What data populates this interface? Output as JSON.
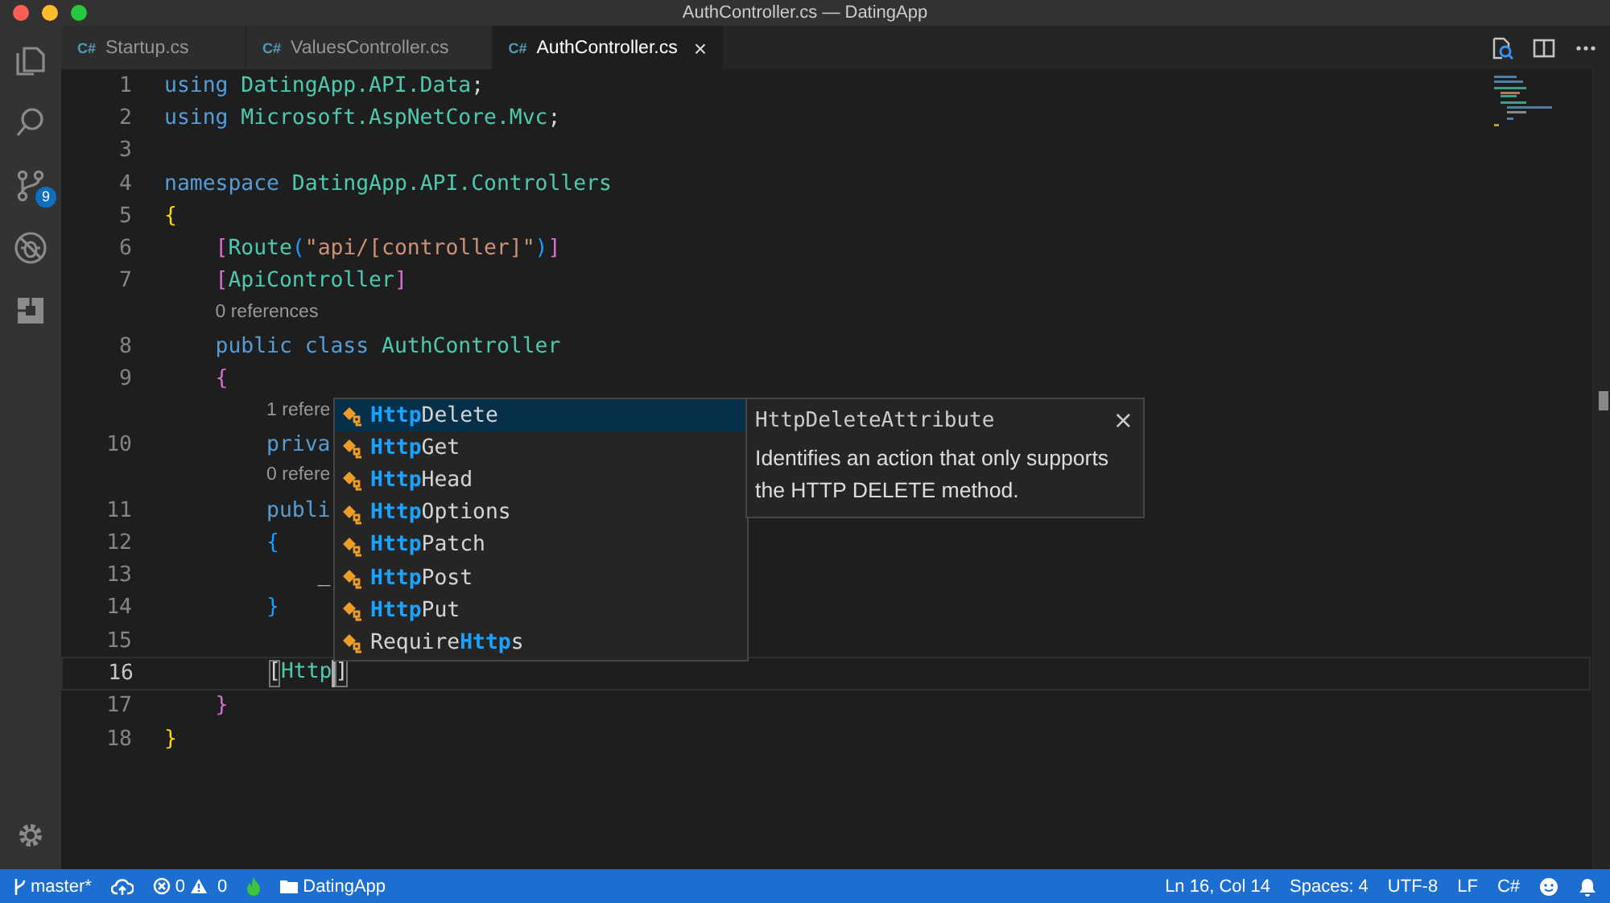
{
  "window": {
    "title": "AuthController.cs — DatingApp"
  },
  "activity_bar": {
    "source_control_badge": "9"
  },
  "tabs": [
    {
      "lang": "C#",
      "label": "Startup.cs",
      "selected": false
    },
    {
      "lang": "C#",
      "label": "ValuesController.cs",
      "selected": false
    },
    {
      "lang": "C#",
      "label": "AuthController.cs",
      "selected": true,
      "close": "×"
    }
  ],
  "editor": {
    "rows": [
      {
        "kind": "code",
        "number": "1",
        "current": false,
        "tokens": [
          {
            "kind": "keyword",
            "text": "using"
          },
          {
            "kind": "type",
            "text": " DatingApp.API.Data"
          },
          {
            "kind": "plain",
            "text": ";"
          }
        ]
      },
      {
        "kind": "code",
        "number": "2",
        "current": false,
        "tokens": [
          {
            "kind": "keyword",
            "text": "using"
          },
          {
            "kind": "type",
            "text": " Microsoft.AspNetCore.Mvc"
          },
          {
            "kind": "plain",
            "text": ";"
          }
        ]
      },
      {
        "kind": "code",
        "number": "3",
        "current": false,
        "tokens": []
      },
      {
        "kind": "code",
        "number": "4",
        "current": false,
        "tokens": [
          {
            "kind": "keyword",
            "text": "namespace"
          },
          {
            "kind": "type",
            "text": " DatingApp.API.Controllers"
          }
        ]
      },
      {
        "kind": "code",
        "number": "5",
        "current": false,
        "tokens": [
          {
            "kind": "brace1",
            "text": "{"
          }
        ]
      },
      {
        "kind": "code",
        "number": "6",
        "current": false,
        "tokens": [
          {
            "kind": "brace2",
            "text": "    ["
          },
          {
            "kind": "type",
            "text": "Route"
          },
          {
            "kind": "brace3",
            "text": "("
          },
          {
            "kind": "string",
            "text": "\"api/[controller]\""
          },
          {
            "kind": "brace3",
            "text": ")"
          },
          {
            "kind": "brace2",
            "text": "]"
          }
        ]
      },
      {
        "kind": "code",
        "number": "7",
        "current": false,
        "tokens": [
          {
            "kind": "brace2",
            "text": "    ["
          },
          {
            "kind": "type",
            "text": "ApiController"
          },
          {
            "kind": "brace2",
            "text": "]"
          }
        ]
      },
      {
        "kind": "codelens",
        "text": "    0 references"
      },
      {
        "kind": "code",
        "number": "8",
        "current": false,
        "tokens": [
          {
            "kind": "keyword",
            "text": "    public class"
          },
          {
            "kind": "type",
            "text": " AuthController"
          }
        ]
      },
      {
        "kind": "code",
        "number": "9",
        "current": false,
        "tokens": [
          {
            "kind": "brace2",
            "text": "    {"
          }
        ]
      },
      {
        "kind": "codelens",
        "text": "        1 refere"
      },
      {
        "kind": "code",
        "number": "10",
        "current": false,
        "tokens": [
          {
            "kind": "keyword",
            "text": "        priva"
          }
        ]
      },
      {
        "kind": "codelens",
        "text": "        0 refere"
      },
      {
        "kind": "code",
        "number": "11",
        "current": false,
        "tokens": [
          {
            "kind": "keyword",
            "text": "        publi"
          }
        ]
      },
      {
        "kind": "code",
        "number": "12",
        "current": false,
        "tokens": [
          {
            "kind": "brace3",
            "text": "        {"
          }
        ]
      },
      {
        "kind": "code",
        "number": "13",
        "current": false,
        "tokens": [
          {
            "kind": "plain",
            "text": "            _"
          }
        ]
      },
      {
        "kind": "code",
        "number": "14",
        "current": false,
        "tokens": [
          {
            "kind": "brace3",
            "text": "        }"
          }
        ]
      },
      {
        "kind": "code",
        "number": "15",
        "current": false,
        "tokens": []
      },
      {
        "kind": "code",
        "number": "16",
        "current": true,
        "tokens": [
          {
            "kind": "match",
            "text": "        ["
          },
          {
            "kind": "type",
            "text": "Http"
          },
          {
            "kind": "caret"
          },
          {
            "kind": "match",
            "text": "]"
          }
        ]
      },
      {
        "kind": "code",
        "number": "17",
        "current": false,
        "tokens": [
          {
            "kind": "brace2",
            "text": "    }"
          }
        ]
      },
      {
        "kind": "code",
        "number": "18",
        "current": false,
        "tokens": [
          {
            "kind": "brace1",
            "text": "}"
          }
        ]
      }
    ]
  },
  "suggestions": [
    {
      "selected": true,
      "parts": [
        {
          "text": "Http",
          "match": true
        },
        {
          "text": "Delete",
          "match": false
        }
      ]
    },
    {
      "selected": false,
      "parts": [
        {
          "text": "Http",
          "match": true
        },
        {
          "text": "Get",
          "match": false
        }
      ]
    },
    {
      "selected": false,
      "parts": [
        {
          "text": "Http",
          "match": true
        },
        {
          "text": "Head",
          "match": false
        }
      ]
    },
    {
      "selected": false,
      "parts": [
        {
          "text": "Http",
          "match": true
        },
        {
          "text": "Options",
          "match": false
        }
      ]
    },
    {
      "selected": false,
      "parts": [
        {
          "text": "Http",
          "match": true
        },
        {
          "text": "Patch",
          "match": false
        }
      ]
    },
    {
      "selected": false,
      "parts": [
        {
          "text": "Http",
          "match": true
        },
        {
          "text": "Post",
          "match": false
        }
      ]
    },
    {
      "selected": false,
      "parts": [
        {
          "text": "Http",
          "match": true
        },
        {
          "text": "Put",
          "match": false
        }
      ]
    },
    {
      "selected": false,
      "parts": [
        {
          "text": "Require",
          "match": false
        },
        {
          "text": "Http",
          "match": true
        },
        {
          "text": "s",
          "match": false
        }
      ]
    }
  ],
  "suggestion_details": {
    "title": "HttpDeleteAttribute",
    "close": "×",
    "description": "Identifies an action that only supports the HTTP DELETE method."
  },
  "status_bar": {
    "branch": "master*",
    "errors": "0",
    "warnings": "0",
    "folder": "DatingApp",
    "right": [
      "Ln 16, Col 14",
      "Spaces: 4",
      "UTF-8",
      "LF",
      "C#"
    ]
  }
}
